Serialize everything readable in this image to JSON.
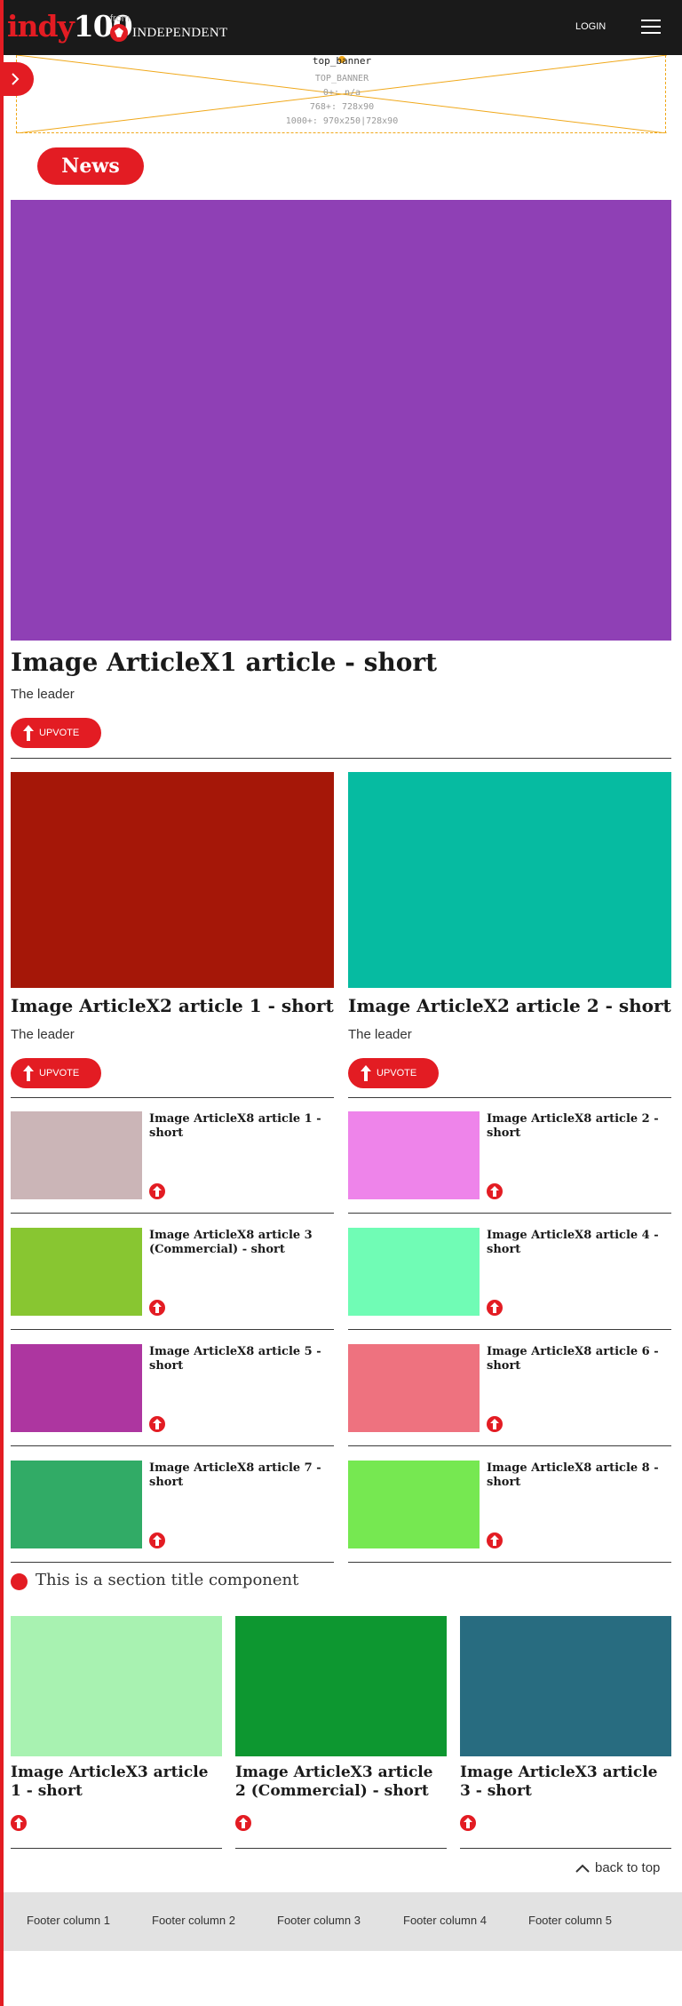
{
  "header": {
    "logo_part1": "indy",
    "logo_part2": "100",
    "from_label": "from",
    "partner_name": "INDEPENDENT",
    "login_label": "LOGIN"
  },
  "ad_slot": {
    "slot_name": "top_banner",
    "slot_code": "TOP_BANNER",
    "rule_small": "0+: n/a",
    "rule_medium": "768+: 728x90",
    "rule_large": "1000+: 970x250|728x90"
  },
  "section_pill": "News",
  "hero": {
    "title": "Image ArticleX1 article - short",
    "subtitle": "The leader",
    "upvote": "UPVOTE",
    "image_color": "#8f40b5"
  },
  "x2_articles": [
    {
      "title": "Image ArticleX2 article 1 - short",
      "subtitle": "The leader",
      "upvote": "UPVOTE",
      "image_color": "#a51708"
    },
    {
      "title": "Image ArticleX2 article 2 - short",
      "subtitle": "The leader",
      "upvote": "UPVOTE",
      "image_color": "#06bba1"
    }
  ],
  "x8_articles": [
    {
      "title": "Image ArticleX8 article 1 - short",
      "image_color": "#cbb5b7"
    },
    {
      "title": "Image ArticleX8 article 2 - short",
      "image_color": "#ee84ea"
    },
    {
      "title": "Image ArticleX8 article 3 (Commercial) - short",
      "image_color": "#88c631"
    },
    {
      "title": "Image ArticleX8 article 4 - short",
      "image_color": "#70fcb5"
    },
    {
      "title": "Image ArticleX8 article 5 - short",
      "image_color": "#ad36a0"
    },
    {
      "title": "Image ArticleX8 article 6 - short",
      "image_color": "#ee727f"
    },
    {
      "title": "Image ArticleX8 article 7 - short",
      "image_color": "#31ab66"
    },
    {
      "title": "Image ArticleX8 article 8 - short",
      "image_color": "#76e851"
    }
  ],
  "section_title": "This is a section title component",
  "x3_articles": [
    {
      "title": "Image ArticleX3 article 1 - short",
      "image_color": "#a8f2b1"
    },
    {
      "title": "Image ArticleX3 article 2 (Commercial) - short",
      "image_color": "#0d9730"
    },
    {
      "title": "Image ArticleX3 article 3 - short",
      "image_color": "#286c80"
    }
  ],
  "back_to_top": "back to top",
  "footer": {
    "columns": [
      "Footer column 1",
      "Footer column 2",
      "Footer column 3",
      "Footer column 4",
      "Footer column 5"
    ]
  },
  "colors": {
    "accent": "#e31c23",
    "header_bg": "#1a1a1a",
    "footer_bg": "#e2e2e2",
    "ad_border": "#f0a81a"
  }
}
